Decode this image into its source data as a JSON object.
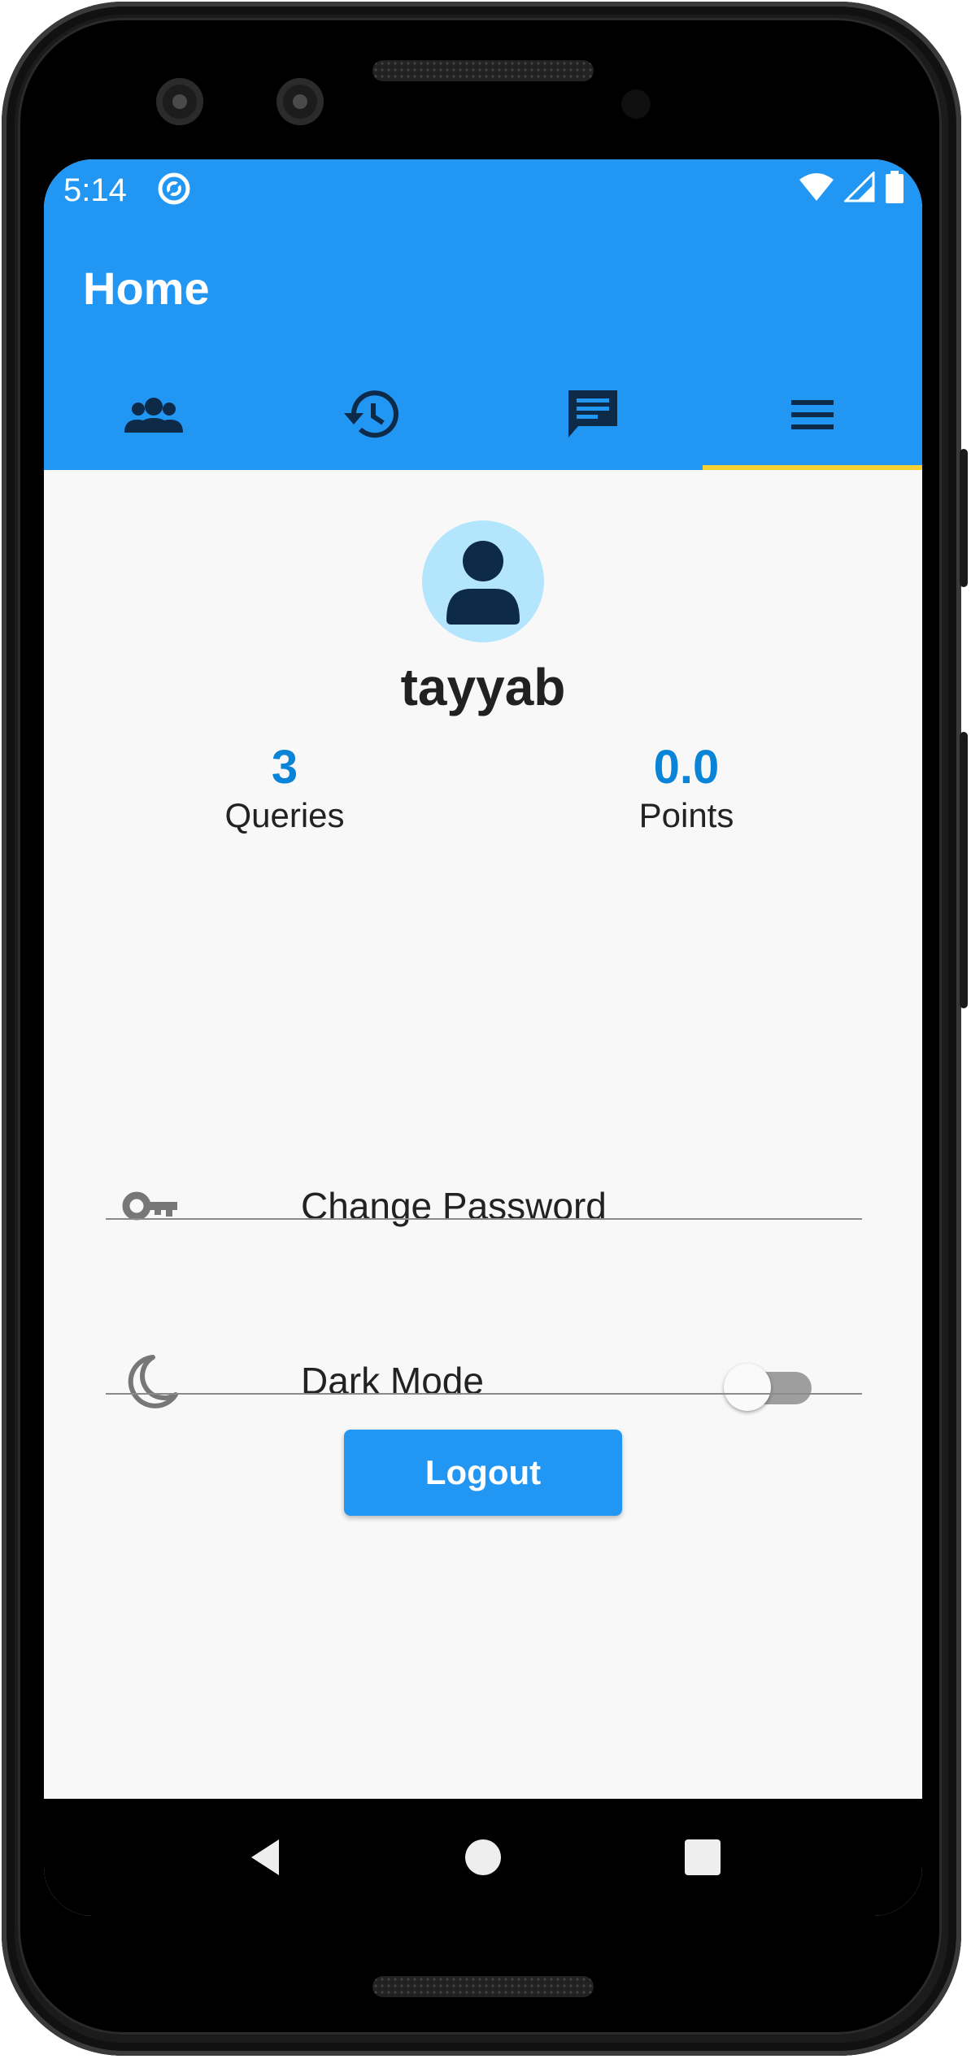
{
  "status_bar": {
    "time": "5:14",
    "icons": [
      "app-sync-icon",
      "wifi-icon",
      "signal-icon",
      "battery-icon"
    ]
  },
  "app_bar": {
    "title": "Home",
    "color": "#2196f3",
    "tabs": [
      {
        "icon": "groups-icon",
        "selected": false
      },
      {
        "icon": "history-icon",
        "selected": false
      },
      {
        "icon": "chat-icon",
        "selected": false
      },
      {
        "icon": "menu-icon",
        "selected": true
      }
    ],
    "indicator_color": "#f2d234"
  },
  "profile": {
    "username": "tayyab",
    "stats": [
      {
        "value": "3",
        "label": "Queries"
      },
      {
        "value": "0.0",
        "label": "Points"
      }
    ]
  },
  "settings": {
    "change_password": "Change Password",
    "dark_mode": "Dark Mode",
    "dark_mode_enabled": false
  },
  "logout": {
    "label": "Logout"
  },
  "navigation_bar": {
    "buttons": [
      "back-icon",
      "home-icon",
      "recents-icon"
    ]
  }
}
